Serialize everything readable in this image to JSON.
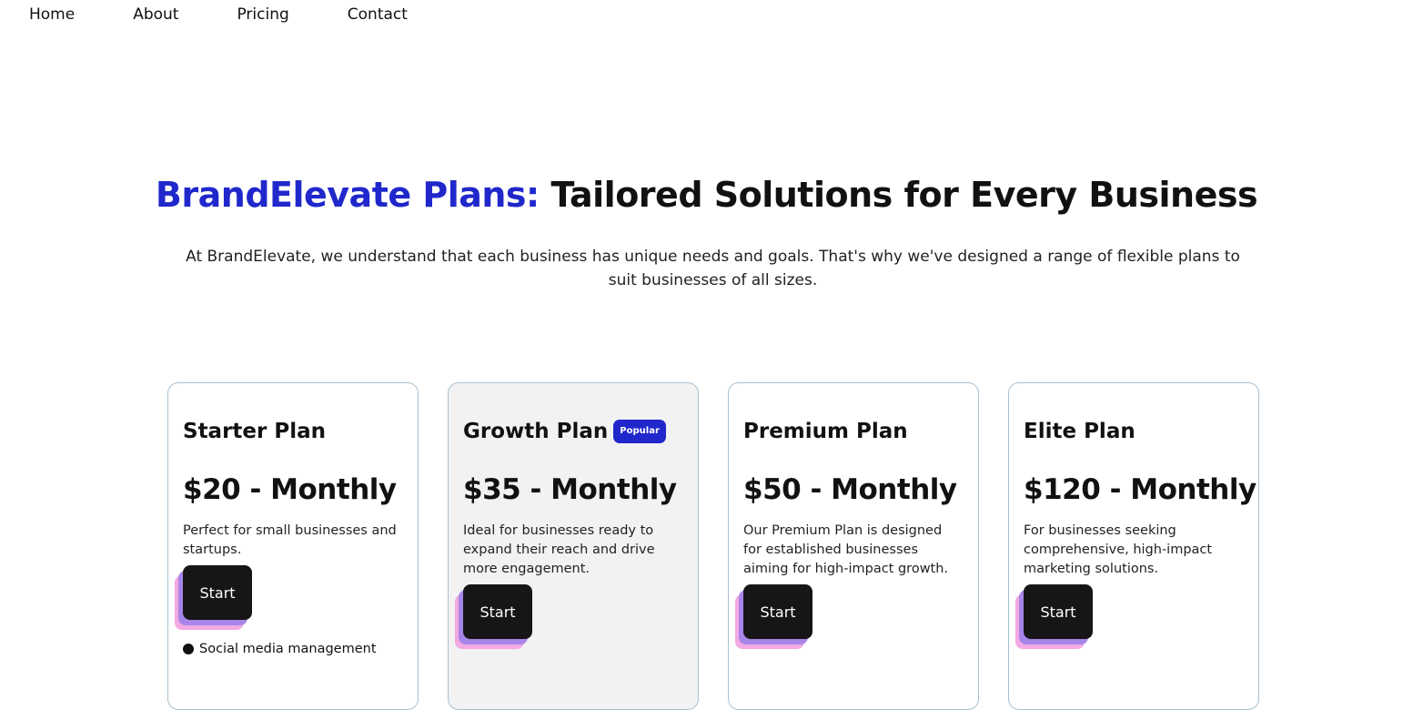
{
  "nav": {
    "items": [
      {
        "label": "Home"
      },
      {
        "label": "About"
      },
      {
        "label": "Pricing"
      },
      {
        "label": "Contact"
      }
    ]
  },
  "hero": {
    "title_brand": "BrandElevate Plans:",
    "title_rest": "Tailored Solutions for Every Business",
    "description": "At BrandElevate, we understand that each business has unique needs and goals. That's why we've designed a range of flexible plans to suit businesses of all sizes."
  },
  "colors": {
    "accent": "#2028cc",
    "button": "#161616",
    "button_shadow_purple": "#a785e8",
    "button_shadow_pink": "#f3a9e3",
    "card_border": "#a9c0d0",
    "featured_card_bg": "#f2f2f2"
  },
  "plans": [
    {
      "name": "Starter Plan",
      "price": "$20 - Monthly",
      "description": "Perfect for small businesses and startups.",
      "button_label": "Start",
      "features": [
        "Social media management"
      ]
    },
    {
      "name": "Growth Plan",
      "badge": "Popular",
      "price": "$35 - Monthly",
      "description": "Ideal for businesses ready to expand their reach and drive more engagement.",
      "button_label": "Start"
    },
    {
      "name": "Premium Plan",
      "price": "$50 - Monthly",
      "description": "Our Premium Plan is designed for established businesses aiming for high-impact growth.",
      "button_label": "Start"
    },
    {
      "name": "Elite Plan",
      "price": "$120 - Monthly",
      "description": "For businesses seeking comprehensive, high-impact marketing solutions.",
      "button_label": "Start"
    }
  ]
}
